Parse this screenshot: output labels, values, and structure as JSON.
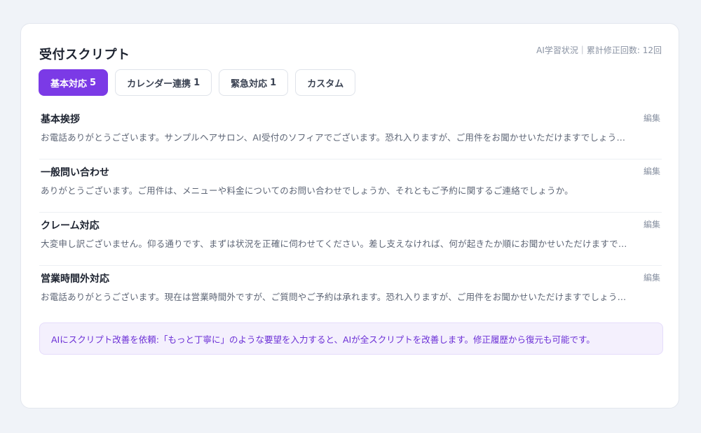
{
  "header": {
    "title": "受付スクリプト",
    "meta": "AI学習状況｜累計修正回数: 12回"
  },
  "tabs": [
    {
      "label": "基本対応",
      "count": "5",
      "active": true
    },
    {
      "label": "カレンダー連携",
      "count": "1",
      "active": false
    },
    {
      "label": "緊急対応",
      "count": "1",
      "active": false
    },
    {
      "label": "カスタム",
      "count": "",
      "active": false
    }
  ],
  "scripts": [
    {
      "title": "基本挨拶",
      "edit_label": "編集",
      "body": "お電話ありがとうございます。サンプルヘアサロン、AI受付のソフィアでございます。恐れ入りますが、ご用件をお聞かせいただけますでしょう…"
    },
    {
      "title": "一般問い合わせ",
      "edit_label": "編集",
      "body": "ありがとうございます。ご用件は、メニューや料金についてのお問い合わせでしょうか、それともご予約に関するご連絡でしょうか。"
    },
    {
      "title": "クレーム対応",
      "edit_label": "編集",
      "body": "大変申し訳ございません。仰る通りです、まずは状況を正確に伺わせてください。差し支えなければ、何が起きたか順にお聞かせいただけますで…"
    },
    {
      "title": "営業時間外対応",
      "edit_label": "編集",
      "body": "お電話ありがとうございます。現在は営業時間外ですが、ご質問やご予約は承れます。恐れ入りますが、ご用件をお聞かせいただけますでしょう…"
    }
  ],
  "hint": "AIにスクリプト改善を依頼:「もっと丁寧に」のような要望を入力すると、AIが全スクリプトを改善します。修正履歴から復元も可能です。",
  "colors": {
    "accent": "#7b3ae6",
    "hint_background": "#f4f0fd",
    "hint_text": "#6b2fd6"
  }
}
